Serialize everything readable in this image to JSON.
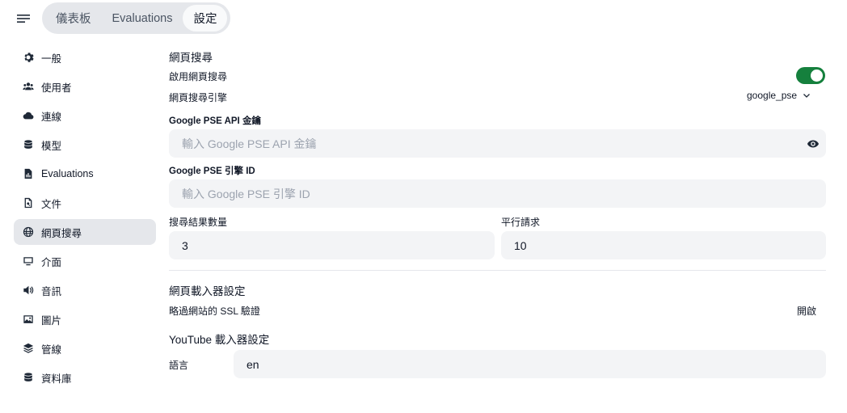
{
  "topnav": {
    "tabs": [
      {
        "label": "儀表板"
      },
      {
        "label": "Evaluations"
      },
      {
        "label": "設定"
      }
    ]
  },
  "sidebar": {
    "items": [
      {
        "label": "一般",
        "icon": "gear-icon"
      },
      {
        "label": "使用者",
        "icon": "users-icon"
      },
      {
        "label": "連線",
        "icon": "cloud-icon"
      },
      {
        "label": "模型",
        "icon": "database-icon"
      },
      {
        "label": "Evaluations",
        "icon": "document-chart-icon"
      },
      {
        "label": "文件",
        "icon": "document-search-icon"
      },
      {
        "label": "網頁搜尋",
        "icon": "globe-icon"
      },
      {
        "label": "介面",
        "icon": "monitor-icon"
      },
      {
        "label": "音訊",
        "icon": "speaker-icon"
      },
      {
        "label": "圖片",
        "icon": "image-icon"
      },
      {
        "label": "管線",
        "icon": "layers-icon"
      },
      {
        "label": "資料庫",
        "icon": "database-icon"
      }
    ]
  },
  "web_search": {
    "title": "網頁搜尋",
    "enable_label": "啟用網頁搜尋",
    "enabled": true,
    "engine_label": "網頁搜尋引擎",
    "engine_value": "google_pse",
    "api_key_label": "Google PSE API 金鑰",
    "api_key_placeholder": "輸入 Google PSE API 金鑰",
    "engine_id_label": "Google PSE 引擎 ID",
    "engine_id_placeholder": "輸入 Google PSE 引擎 ID",
    "result_count_label": "搜尋結果數量",
    "result_count_value": "3",
    "concurrent_label": "平行請求",
    "concurrent_value": "10"
  },
  "loader": {
    "title": "網頁載入器設定",
    "ssl_label": "略過網站的 SSL 驗證",
    "ssl_value": "開啟"
  },
  "youtube": {
    "title": "YouTube 載入器設定",
    "language_label": "語言",
    "language_value": "en"
  },
  "colors": {
    "toggle_on": "#15803d",
    "active_bg": "#e5e7eb",
    "input_bg": "#f3f4f6"
  }
}
